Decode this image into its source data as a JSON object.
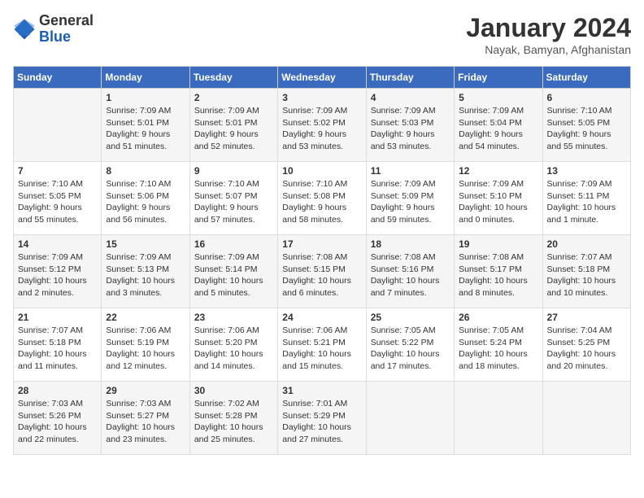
{
  "header": {
    "logo_line1": "General",
    "logo_line2": "Blue",
    "month": "January 2024",
    "location": "Nayak, Bamyan, Afghanistan"
  },
  "weekdays": [
    "Sunday",
    "Monday",
    "Tuesday",
    "Wednesday",
    "Thursday",
    "Friday",
    "Saturday"
  ],
  "weeks": [
    [
      {
        "day": "",
        "text": ""
      },
      {
        "day": "1",
        "text": "Sunrise: 7:09 AM\nSunset: 5:01 PM\nDaylight: 9 hours\nand 51 minutes."
      },
      {
        "day": "2",
        "text": "Sunrise: 7:09 AM\nSunset: 5:01 PM\nDaylight: 9 hours\nand 52 minutes."
      },
      {
        "day": "3",
        "text": "Sunrise: 7:09 AM\nSunset: 5:02 PM\nDaylight: 9 hours\nand 53 minutes."
      },
      {
        "day": "4",
        "text": "Sunrise: 7:09 AM\nSunset: 5:03 PM\nDaylight: 9 hours\nand 53 minutes."
      },
      {
        "day": "5",
        "text": "Sunrise: 7:09 AM\nSunset: 5:04 PM\nDaylight: 9 hours\nand 54 minutes."
      },
      {
        "day": "6",
        "text": "Sunrise: 7:10 AM\nSunset: 5:05 PM\nDaylight: 9 hours\nand 55 minutes."
      }
    ],
    [
      {
        "day": "7",
        "text": "Sunrise: 7:10 AM\nSunset: 5:05 PM\nDaylight: 9 hours\nand 55 minutes."
      },
      {
        "day": "8",
        "text": "Sunrise: 7:10 AM\nSunset: 5:06 PM\nDaylight: 9 hours\nand 56 minutes."
      },
      {
        "day": "9",
        "text": "Sunrise: 7:10 AM\nSunset: 5:07 PM\nDaylight: 9 hours\nand 57 minutes."
      },
      {
        "day": "10",
        "text": "Sunrise: 7:10 AM\nSunset: 5:08 PM\nDaylight: 9 hours\nand 58 minutes."
      },
      {
        "day": "11",
        "text": "Sunrise: 7:09 AM\nSunset: 5:09 PM\nDaylight: 9 hours\nand 59 minutes."
      },
      {
        "day": "12",
        "text": "Sunrise: 7:09 AM\nSunset: 5:10 PM\nDaylight: 10 hours\nand 0 minutes."
      },
      {
        "day": "13",
        "text": "Sunrise: 7:09 AM\nSunset: 5:11 PM\nDaylight: 10 hours\nand 1 minute."
      }
    ],
    [
      {
        "day": "14",
        "text": "Sunrise: 7:09 AM\nSunset: 5:12 PM\nDaylight: 10 hours\nand 2 minutes."
      },
      {
        "day": "15",
        "text": "Sunrise: 7:09 AM\nSunset: 5:13 PM\nDaylight: 10 hours\nand 3 minutes."
      },
      {
        "day": "16",
        "text": "Sunrise: 7:09 AM\nSunset: 5:14 PM\nDaylight: 10 hours\nand 5 minutes."
      },
      {
        "day": "17",
        "text": "Sunrise: 7:08 AM\nSunset: 5:15 PM\nDaylight: 10 hours\nand 6 minutes."
      },
      {
        "day": "18",
        "text": "Sunrise: 7:08 AM\nSunset: 5:16 PM\nDaylight: 10 hours\nand 7 minutes."
      },
      {
        "day": "19",
        "text": "Sunrise: 7:08 AM\nSunset: 5:17 PM\nDaylight: 10 hours\nand 8 minutes."
      },
      {
        "day": "20",
        "text": "Sunrise: 7:07 AM\nSunset: 5:18 PM\nDaylight: 10 hours\nand 10 minutes."
      }
    ],
    [
      {
        "day": "21",
        "text": "Sunrise: 7:07 AM\nSunset: 5:18 PM\nDaylight: 10 hours\nand 11 minutes."
      },
      {
        "day": "22",
        "text": "Sunrise: 7:06 AM\nSunset: 5:19 PM\nDaylight: 10 hours\nand 12 minutes."
      },
      {
        "day": "23",
        "text": "Sunrise: 7:06 AM\nSunset: 5:20 PM\nDaylight: 10 hours\nand 14 minutes."
      },
      {
        "day": "24",
        "text": "Sunrise: 7:06 AM\nSunset: 5:21 PM\nDaylight: 10 hours\nand 15 minutes."
      },
      {
        "day": "25",
        "text": "Sunrise: 7:05 AM\nSunset: 5:22 PM\nDaylight: 10 hours\nand 17 minutes."
      },
      {
        "day": "26",
        "text": "Sunrise: 7:05 AM\nSunset: 5:24 PM\nDaylight: 10 hours\nand 18 minutes."
      },
      {
        "day": "27",
        "text": "Sunrise: 7:04 AM\nSunset: 5:25 PM\nDaylight: 10 hours\nand 20 minutes."
      }
    ],
    [
      {
        "day": "28",
        "text": "Sunrise: 7:03 AM\nSunset: 5:26 PM\nDaylight: 10 hours\nand 22 minutes."
      },
      {
        "day": "29",
        "text": "Sunrise: 7:03 AM\nSunset: 5:27 PM\nDaylight: 10 hours\nand 23 minutes."
      },
      {
        "day": "30",
        "text": "Sunrise: 7:02 AM\nSunset: 5:28 PM\nDaylight: 10 hours\nand 25 minutes."
      },
      {
        "day": "31",
        "text": "Sunrise: 7:01 AM\nSunset: 5:29 PM\nDaylight: 10 hours\nand 27 minutes."
      },
      {
        "day": "",
        "text": ""
      },
      {
        "day": "",
        "text": ""
      },
      {
        "day": "",
        "text": ""
      }
    ]
  ]
}
